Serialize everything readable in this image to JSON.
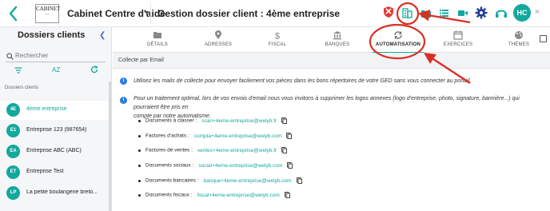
{
  "topbar": {
    "logo_text": "CABINET",
    "logo_sub": "• • •",
    "cabinet_name": "Cabinet Centre d'aide",
    "page_title": "Gestion dossier client : 4ème entreprise",
    "avatar_initials": "HC",
    "icons": [
      "shield-icon",
      "building-icon",
      "folder-icon",
      "list-icon",
      "video-icon",
      "gear-icon",
      "support-icon"
    ]
  },
  "sidebar": {
    "title": "Dossiers clients",
    "search_placeholder": "Rechercher",
    "sort_label": "AZ",
    "section_label": "Dossiers clients",
    "clients": [
      {
        "initials": "4E",
        "name": "4ème entreprise",
        "active": true
      },
      {
        "initials": "E1",
        "name": "Entreprise 123 (987654)",
        "active": false
      },
      {
        "initials": "EA",
        "name": "Entreprise ABC (ABC)",
        "active": false
      },
      {
        "initials": "ET",
        "name": "Entreprise Test",
        "active": false
      },
      {
        "initials": "LP",
        "name": "La petite boulangerie breto...",
        "active": false
      }
    ]
  },
  "tabs": [
    {
      "label": "DÉTAILS",
      "icon": "folder-icon"
    },
    {
      "label": "ADRESSES",
      "icon": "map-pin-icon"
    },
    {
      "label": "FISCAL",
      "icon": "dollar-icon"
    },
    {
      "label": "BANQUES",
      "icon": "bank-icon"
    },
    {
      "label": "AUTOMATISATION",
      "icon": "sync-icon",
      "active": true
    },
    {
      "label": "EXERCICES",
      "icon": "calendar-icon"
    },
    {
      "label": "THÈMES",
      "icon": "palette-icon"
    }
  ],
  "content": {
    "section_title": "Collecte par Email",
    "info_1": "Utilisez les mails de collecte pour envoyer facilement vos pièces dans les bons répertoires de votre GED sans vous connecter au portail.",
    "info_2_line1": "Pour un traitement optimal, lors de vos envois d'email nous vous invitons à supprimer les logos annexes (logo d'entreprise, photo, signature, bannière...) qui pourraient être pris en",
    "info_2_line2": "compte par notre automatisme.",
    "docs": [
      {
        "label": "Documents à classer :",
        "email": "scan+4eme-entreprise@welyb.fr"
      },
      {
        "label": "Factures d'achats :",
        "email": "compta+4eme-entreprise@welyb.com"
      },
      {
        "label": "Factures de ventes :",
        "email": "ventes+4eme-entreprise@welyb.fr"
      },
      {
        "label": "Documents sociaux :",
        "email": "social+4eme-entreprise@welyb.com"
      },
      {
        "label": "Documents bancaires :",
        "email": "banque+4eme-entreprise@welyb.com"
      },
      {
        "label": "Documents fiscaux :",
        "email": "fiscal+4eme-entreprise@welyb.com"
      }
    ]
  },
  "colors": {
    "accent": "#13a89e",
    "annotation": "#d93025",
    "info_blue": "#2c7be5"
  }
}
